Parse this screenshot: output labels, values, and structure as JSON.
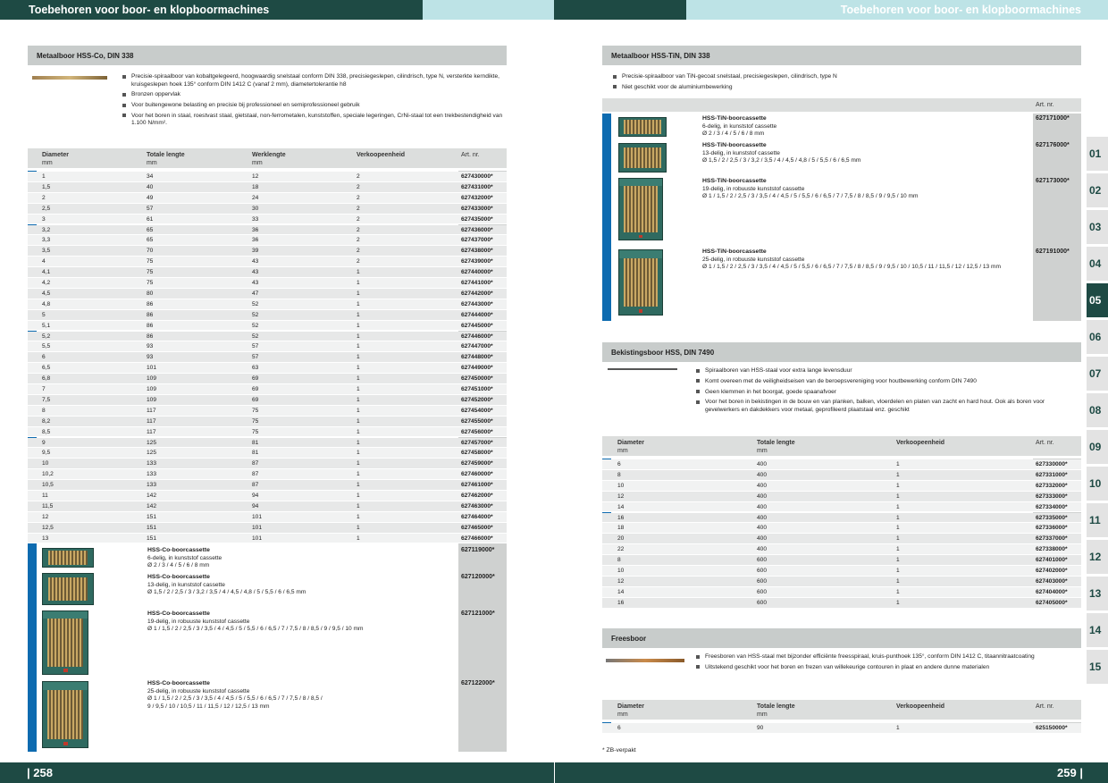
{
  "header": {
    "left_title": "Toebehoren voor boor- en klopboormachines",
    "right_title": "Toebehoren voor boor- en klopboormachines"
  },
  "footer": {
    "left_page": "| 258",
    "right_page": "259 |"
  },
  "tabs": [
    "01",
    "02",
    "03",
    "04",
    "05",
    "06",
    "07",
    "08",
    "09",
    "10",
    "11",
    "12",
    "13",
    "14",
    "15"
  ],
  "active_tab": "05",
  "left": {
    "section_title": "Metaalboor HSS-Co, DIN 338",
    "bullets": [
      "Precisie-spiraalboor van kobaltgelegeerd, hoogwaardig snelstaal conform DIN 338, precisiegeslepen, cilindrisch, type N, versterkte kerndikte, kruisgeslepen hoek 135° conform DIN 1412 C (vanaf 2 mm), diametertolerantie h8",
      "Bronzen oppervlak",
      "Voor buitengewone belasting en precisie bij professioneel en semiprofessioneel gebruik",
      "Voor het boren in staal, roestvast staal, gietstaal, non-ferrometalen, kunststoffen, speciale legeringen, CrNi-staal tot een trekbestendigheid van 1.100 N/mm²."
    ],
    "columns": [
      "Diameter",
      "Totale lengte",
      "Werklengte",
      "Verkoopeenheid",
      "Art. nr."
    ],
    "units": [
      "mm",
      "mm",
      "mm",
      "",
      ""
    ],
    "rows": [
      [
        "1",
        "34",
        "12",
        "2",
        "627430000*"
      ],
      [
        "1,5",
        "40",
        "18",
        "2",
        "627431000*"
      ],
      [
        "2",
        "49",
        "24",
        "2",
        "627432000*"
      ],
      [
        "2,5",
        "57",
        "30",
        "2",
        "627433000*"
      ],
      [
        "3",
        "61",
        "33",
        "2",
        "627435000*"
      ],
      [
        "3,2",
        "65",
        "36",
        "2",
        "627436000*"
      ],
      [
        "3,3",
        "65",
        "36",
        "2",
        "627437000*"
      ],
      [
        "3,5",
        "70",
        "39",
        "2",
        "627438000*"
      ],
      [
        "4",
        "75",
        "43",
        "2",
        "627439000*"
      ],
      [
        "4,1",
        "75",
        "43",
        "1",
        "627440000*"
      ],
      [
        "4,2",
        "75",
        "43",
        "1",
        "627441000*"
      ],
      [
        "4,5",
        "80",
        "47",
        "1",
        "627442000*"
      ],
      [
        "4,8",
        "86",
        "52",
        "1",
        "627443000*"
      ],
      [
        "5",
        "86",
        "52",
        "1",
        "627444000*"
      ],
      [
        "5,1",
        "86",
        "52",
        "1",
        "627445000*"
      ],
      [
        "5,2",
        "86",
        "52",
        "1",
        "627446000*"
      ],
      [
        "5,5",
        "93",
        "57",
        "1",
        "627447000*"
      ],
      [
        "6",
        "93",
        "57",
        "1",
        "627448000*"
      ],
      [
        "6,5",
        "101",
        "63",
        "1",
        "627449000*"
      ],
      [
        "6,8",
        "109",
        "69",
        "1",
        "627450000*"
      ],
      [
        "7",
        "109",
        "69",
        "1",
        "627451000*"
      ],
      [
        "7,5",
        "109",
        "69",
        "1",
        "627452000*"
      ],
      [
        "8",
        "117",
        "75",
        "1",
        "627454000*"
      ],
      [
        "8,2",
        "117",
        "75",
        "1",
        "627455000*"
      ],
      [
        "8,5",
        "117",
        "75",
        "1",
        "627456000*"
      ],
      [
        "9",
        "125",
        "81",
        "1",
        "627457000*"
      ],
      [
        "9,5",
        "125",
        "81",
        "1",
        "627458000*"
      ],
      [
        "10",
        "133",
        "87",
        "1",
        "627459000*"
      ],
      [
        "10,2",
        "133",
        "87",
        "1",
        "627460000*"
      ],
      [
        "10,5",
        "133",
        "87",
        "1",
        "627461000*"
      ],
      [
        "11",
        "142",
        "94",
        "1",
        "627462000*"
      ],
      [
        "11,5",
        "142",
        "94",
        "1",
        "627463000*"
      ],
      [
        "12",
        "151",
        "101",
        "1",
        "627464000*"
      ],
      [
        "12,5",
        "151",
        "101",
        "1",
        "627465000*"
      ],
      [
        "13",
        "151",
        "101",
        "1",
        "627466000*"
      ]
    ],
    "cassettes": [
      {
        "title": "HSS-Co-boorcassette",
        "line1": "6-delig, in kunststof cassette",
        "line2": "Ø 2 / 3 / 4 / 5 / 6 / 8 mm",
        "line3": "",
        "art": "627119000*"
      },
      {
        "title": "HSS-Co-boorcassette",
        "line1": "13-delig, in kunststof cassette",
        "line2": "Ø 1,5 / 2 / 2,5 / 3 / 3,2 / 3,5 / 4 / 4,5 / 4,8 / 5 / 5,5 / 6 / 6,5 mm",
        "line3": "",
        "art": "627120000*"
      },
      {
        "title": "HSS-Co-boorcassette",
        "line1": "19-delig, in robuuste kunststof cassette",
        "line2": "Ø 1 / 1,5 / 2 / 2,5 / 3 / 3,5 / 4 / 4,5 / 5 / 5,5 / 6 / 6,5 / 7 / 7,5 / 8 / 8,5 / 9 / 9,5 / 10 mm",
        "line3": "",
        "art": "627121000*"
      },
      {
        "title": "HSS-Co-boorcassette",
        "line1": "25-delig, in robuuste kunststof cassette",
        "line2": "Ø 1 / 1,5 / 2 / 2,5 / 3 / 3,5 / 4 / 4,5 / 5 / 5,5 / 6 / 6,5 / 7 / 7,5 / 8 / 8,5 /",
        "line3": "9 / 9,5 / 10 / 10,5 / 11 / 11,5 / 12 / 12,5 / 13 mm",
        "art": "627122000*"
      }
    ]
  },
  "right": {
    "tin": {
      "section_title": "Metaalboor HSS-TiN, DIN 338",
      "bullets": [
        "Precisie-spiraalboor van TiN-gecoat snelstaal, precisiegeslepen, cilindrisch, type N",
        "Niet geschikt voor de aluminiumbewerking"
      ],
      "art_header": "Art. nr.",
      "cassettes": [
        {
          "title": "HSS-TiN-boorcassette",
          "line1": "6-delig, in kunststof cassette",
          "line2": "Ø 2 / 3 / 4 / 5 / 6 / 8 mm",
          "art": "627171000*"
        },
        {
          "title": "HSS-TiN-boorcassette",
          "line1": "13-delig, in kunststof cassette",
          "line2": "Ø 1,5 / 2 / 2,5 / 3 / 3,2 / 3,5 / 4 / 4,5 / 4,8 / 5 / 5,5 / 6 / 6,5 mm",
          "art": "627176000*"
        },
        {
          "title": "HSS-TiN-boorcassette",
          "line1": "19-delig, in robuuste kunststof cassette",
          "line2": "Ø 1 / 1,5 / 2 / 2,5 / 3 / 3,5 / 4 / 4,5 / 5 / 5,5 / 6 / 6,5 / 7 / 7,5 / 8 / 8,5 / 9 / 9,5 / 10 mm",
          "art": "627173000*"
        },
        {
          "title": "HSS-TiN-boorcassette",
          "line1": "25-delig, in robuuste kunststof cassette",
          "line2": "Ø 1 / 1,5 / 2 / 2,5 / 3 / 3,5 / 4 / 4,5 / 5 / 5,5 / 6 / 6,5 / 7 / 7,5 / 8 / 8,5 / 9 / 9,5 / 10 / 10,5 / 11 / 11,5 / 12 / 12,5 / 13 mm",
          "art": "627191000*"
        }
      ]
    },
    "bekisting": {
      "section_title": "Bekistingsboor HSS, DIN 7490",
      "bullets": [
        "Spiraalboren van HSS-staal voor extra lange levensduur",
        "Komt overeen met de veiligheidseisen van de beroepsvereniging voor houtbewerking conform DIN 7490",
        "Geen klemmen in het boorgat, goede spaanafvoer",
        "Voor het boren in bekistingen in de bouw en van planken, balken, vloerdelen en platen van zacht en hard hout. Ook als boren voor gevelwerkers en dakdekkers voor metaal, geprofileerd plaatstaal enz. geschikt"
      ],
      "columns": [
        "Diameter",
        "Totale lengte",
        "Verkoopeenheid",
        "Art. nr."
      ],
      "units": [
        "mm",
        "mm",
        "",
        ""
      ],
      "rows": [
        [
          "6",
          "400",
          "1",
          "627330000*"
        ],
        [
          "8",
          "400",
          "1",
          "627331000*"
        ],
        [
          "10",
          "400",
          "1",
          "627332000*"
        ],
        [
          "12",
          "400",
          "1",
          "627333000*"
        ],
        [
          "14",
          "400",
          "1",
          "627334000*"
        ],
        [
          "16",
          "400",
          "1",
          "627335000*"
        ],
        [
          "18",
          "400",
          "1",
          "627336000*"
        ],
        [
          "20",
          "400",
          "1",
          "627337000*"
        ],
        [
          "22",
          "400",
          "1",
          "627338000*"
        ],
        [
          "8",
          "600",
          "1",
          "627401000*"
        ],
        [
          "10",
          "600",
          "1",
          "627402000*"
        ],
        [
          "12",
          "600",
          "1",
          "627403000*"
        ],
        [
          "14",
          "600",
          "1",
          "627404000*"
        ],
        [
          "16",
          "600",
          "1",
          "627405000*"
        ]
      ]
    },
    "frees": {
      "section_title": "Freesboor",
      "bullets": [
        "Freesboren van HSS-staal met bijzonder efficiënte freesspiraal, kruis-punthoek 135°, conform DIN 1412 C, titaannitraatcoating",
        "Uitstekend geschikt voor het boren en frezen van willekeurige contouren in plaat en andere dunne materialen"
      ],
      "columns": [
        "Diameter",
        "Totale lengte",
        "Verkoopeenheid",
        "Art. nr."
      ],
      "units": [
        "mm",
        "mm",
        "",
        ""
      ],
      "rows": [
        [
          "6",
          "90",
          "1",
          "625150000*"
        ]
      ]
    },
    "footnote": "* ZB-verpakt"
  }
}
